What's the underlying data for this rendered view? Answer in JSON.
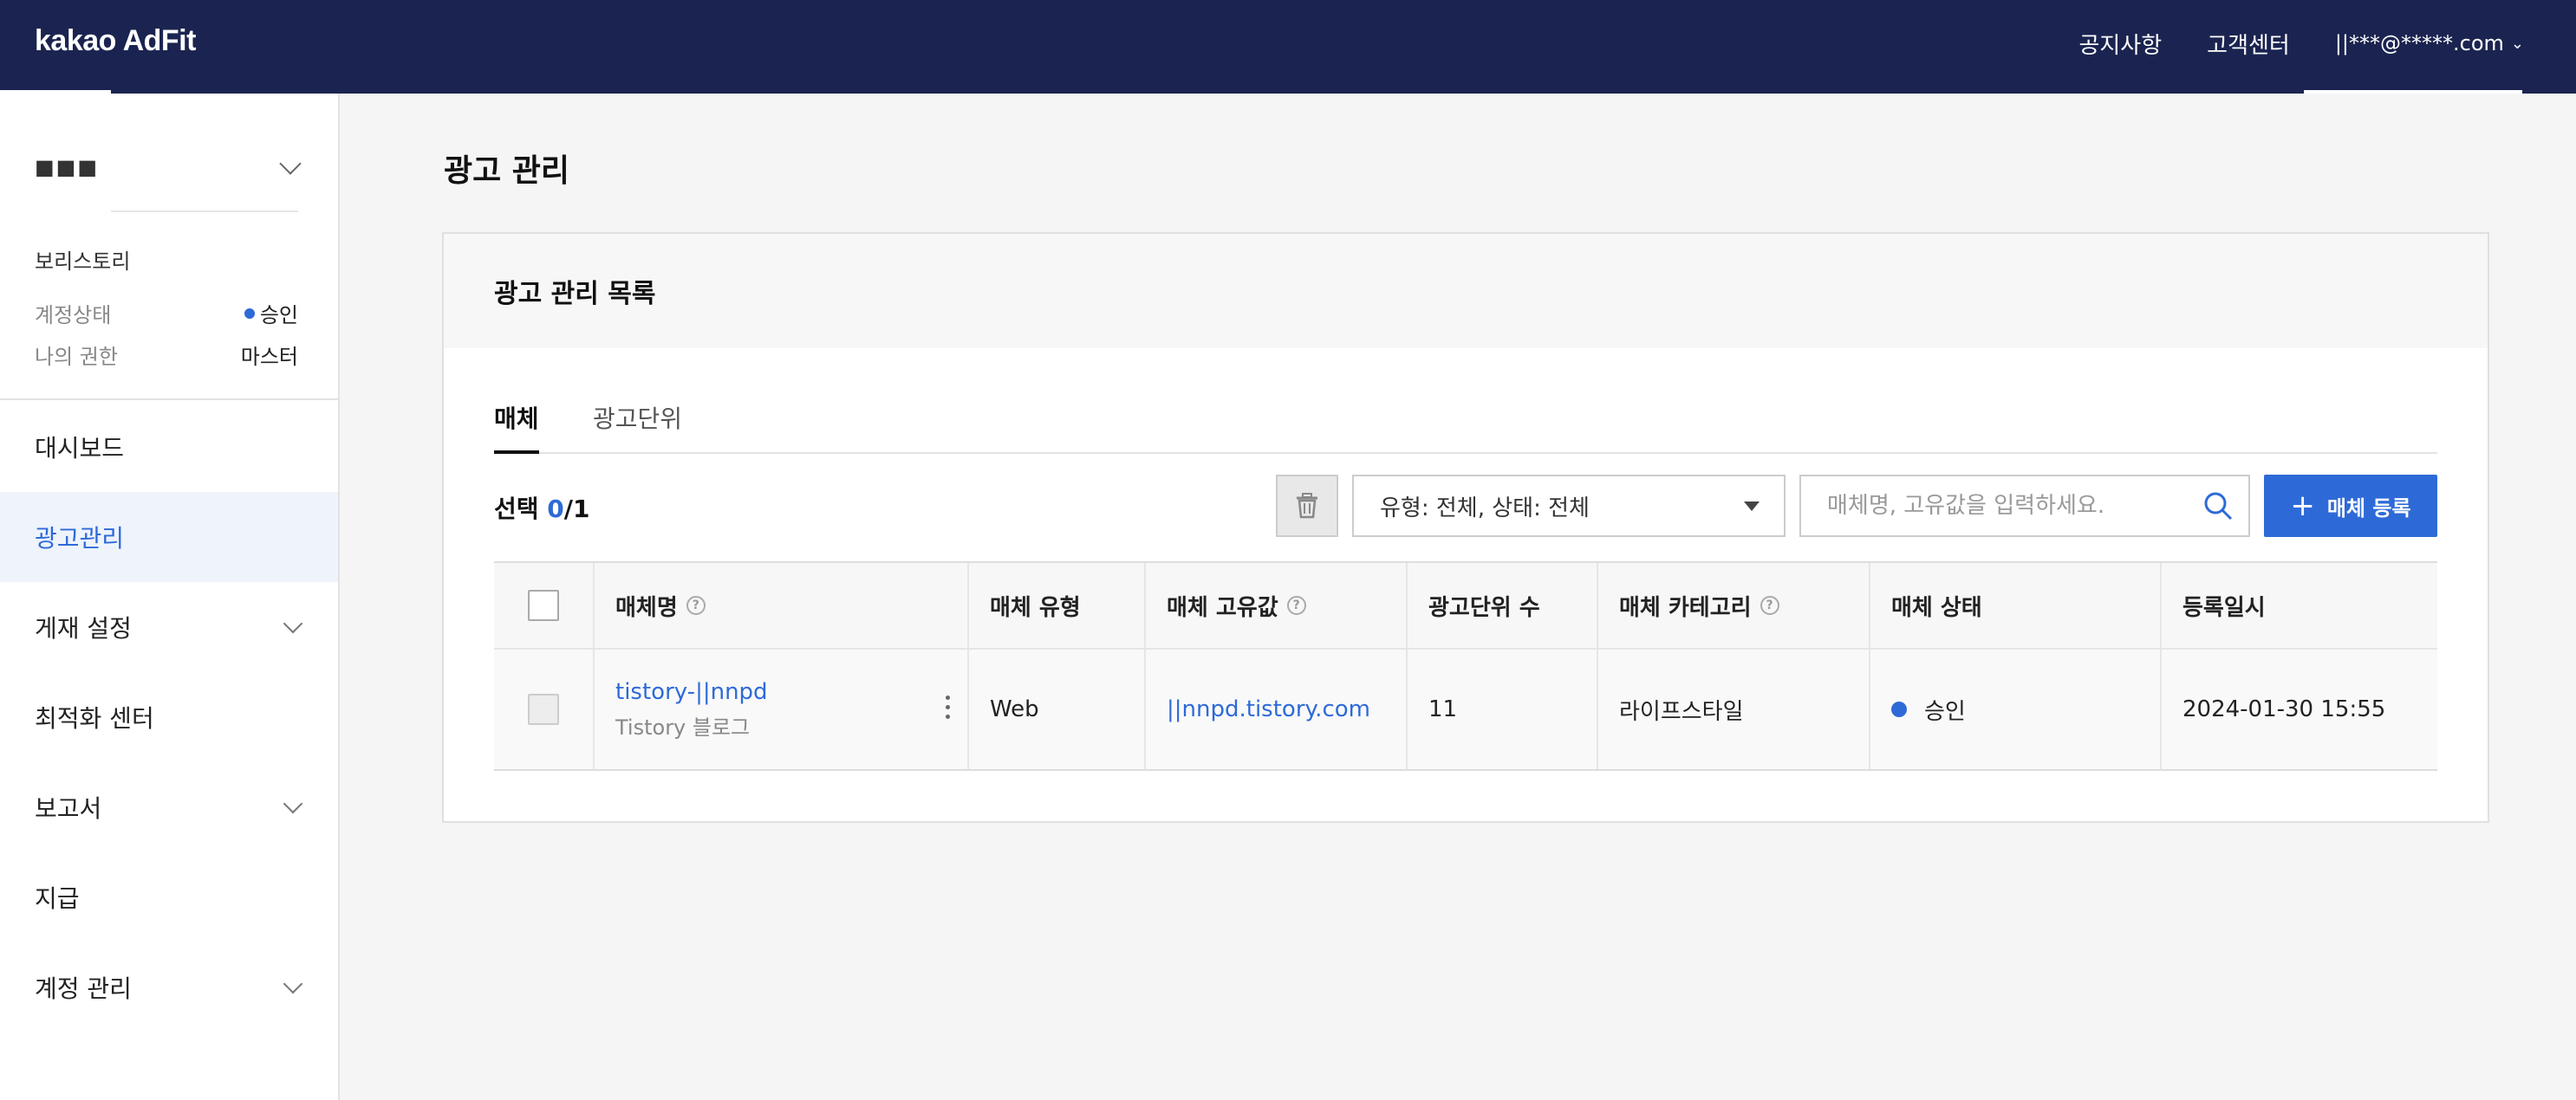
{
  "header": {
    "logo": "kakao AdFit",
    "links": [
      "공지사항",
      "고객센터"
    ],
    "account_email": "||***@*****.com"
  },
  "sidebar": {
    "site_name": "■■■",
    "account_label": "보리스토리",
    "status_key": "계정상태",
    "status_value": "승인",
    "role_key": "나의 권한",
    "role_value": "마스터",
    "items": [
      {
        "label": "대시보드",
        "has_children": false
      },
      {
        "label": "광고관리",
        "has_children": false,
        "active": true
      },
      {
        "label": "게재 설정",
        "has_children": true
      },
      {
        "label": "최적화 센터",
        "has_children": false
      },
      {
        "label": "보고서",
        "has_children": true
      },
      {
        "label": "지급",
        "has_children": false
      },
      {
        "label": "계정 관리",
        "has_children": true
      }
    ]
  },
  "main": {
    "page_title": "광고 관리",
    "card_title": "광고 관리 목록",
    "tabs": [
      "매체",
      "광고단위"
    ],
    "selection": {
      "prefix": "선택 ",
      "selected": "0",
      "total": "/1"
    },
    "filter_value": "유형: 전체, 상태: 전체",
    "search_placeholder": "매체명, 고유값을 입력하세요.",
    "add_button": "매체 등록",
    "table": {
      "headers": [
        "매체명",
        "매체 유형",
        "매체 고유값",
        "광고단위 수",
        "매체 카테고리",
        "매체 상태",
        "등록일시"
      ],
      "rows": [
        {
          "name": "tistory-||nnpd",
          "sub": "Tistory 블로그",
          "type": "Web",
          "id": "||nnpd.tistory.com",
          "units": "11",
          "category": "라이프스타일",
          "status": "승인",
          "registered": "2024-01-30 15:55"
        }
      ]
    }
  },
  "colors": {
    "header_bg": "#1b2450",
    "accent": "#2e6ad7"
  }
}
